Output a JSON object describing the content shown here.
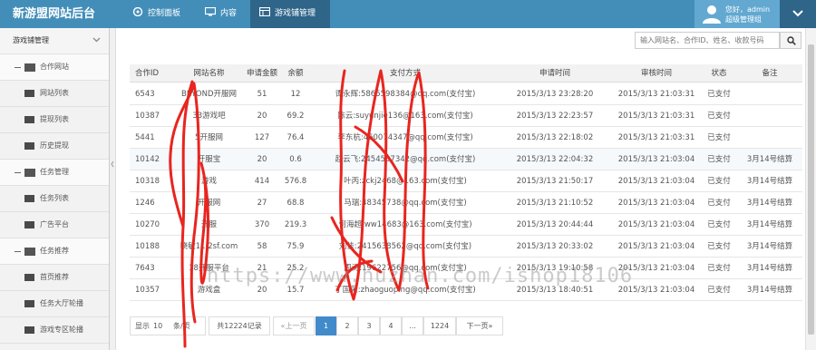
{
  "header": {
    "brand": "新游盟网站后台",
    "tabs": [
      {
        "label": "控制面板",
        "icon": "dashboard-icon",
        "active": false
      },
      {
        "label": "内容",
        "icon": "monitor-icon",
        "active": false
      },
      {
        "label": "游戏铺管理",
        "icon": "grid-icon",
        "active": true
      }
    ],
    "user": {
      "greeting": "您好，admin",
      "role": "超级管理组"
    }
  },
  "sidebar": {
    "title": "游戏铺管理",
    "groups": [
      {
        "label": "合作网站",
        "items": [
          "网站列表",
          "提现列表",
          "历史提现"
        ]
      },
      {
        "label": "任务管理",
        "items": [
          "任务列表",
          "广告平台"
        ]
      },
      {
        "label": "任务推荐",
        "items": [
          "首页推荐",
          "任务大厅轮播",
          "游戏专区轮播"
        ]
      }
    ]
  },
  "search": {
    "placeholder": "输入网站名、合作ID、姓名、收款号码"
  },
  "table": {
    "columns": [
      "合作ID",
      "网站名称",
      "申请金额",
      "余额",
      "支付方式",
      "申请时间",
      "审核时间",
      "状态",
      "备注"
    ],
    "rows": [
      [
        "6543",
        "BEYOND开服网",
        "51",
        "12",
        "谭永辉:5865598384@qq.com(支付宝)",
        "2015/3/13 23:28:20",
        "2015/3/13 21:03:31",
        "已支付",
        ""
      ],
      [
        "10387",
        "33游戏吧",
        "20",
        "69.2",
        "陈云:suyunjie136@163.com(支付宝)",
        "2015/3/13 22:23:57",
        "2015/3/13 21:03:31",
        "已支付",
        ""
      ],
      [
        "5441",
        "5开服网",
        "127",
        "76.4",
        "李东杭:460074347@qq.com(支付宝)",
        "2015/3/13 22:18:02",
        "2015/3/13 21:03:31",
        "已支付",
        ""
      ],
      [
        "10142",
        "开服宝",
        "20",
        "0.6",
        "赵云飞:2454507342@qq.com(支付宝)",
        "2015/3/13 22:04:32",
        "2015/3/13 21:03:04",
        "已支付",
        "3月14号结算"
      ],
      [
        "10318",
        "游戏",
        "414",
        "576.8",
        "叶丙:zckj2468@163.com(支付宝)",
        "2015/3/13 21:50:17",
        "2015/3/13 21:03:04",
        "已支付",
        "3月14号结算"
      ],
      [
        "1246",
        "开服网",
        "27",
        "68.8",
        "马瑞:48345738@qq.com(支付宝)",
        "2015/3/13 21:10:52",
        "2015/3/13 21:03:04",
        "已支付",
        "3月14号结算"
      ],
      [
        "10270",
        "开服",
        "370",
        "219.3",
        "何海超:ww14683@163.com(支付宝)",
        "2015/3/13 20:44:44",
        "2015/3/13 21:03:04",
        "已支付",
        "3月14号结算"
      ],
      [
        "10188",
        "晓敏11.2sf.com",
        "58",
        "75.9",
        "刘佳:2415638562@qq.com(支付宝)",
        "2015/3/13 20:33:02",
        "2015/3/13 21:03:04",
        "已支付",
        "3月14号结算"
      ],
      [
        "7643",
        "18开服平台",
        "21",
        "25.2",
        "周涛:19622756@qq.com(支付宝)",
        "2015/3/13 19:10:58",
        "2015/3/13 21:03:04",
        "已支付",
        "3月14号结算"
      ],
      [
        "10357",
        "游戏盒",
        "20",
        "15.7",
        "丁国荣:zhaoguoping@qq.com(支付宝)",
        "2015/3/13 18:40:51",
        "2015/3/13 21:03:04",
        "已支付",
        "3月14号结算"
      ]
    ]
  },
  "pagination": {
    "show_label": "显示",
    "page_size": "10",
    "page_size_suffix": "条/页",
    "total": "共12224记录",
    "prev": "«上一页",
    "pages": [
      "1",
      "2",
      "3",
      "4",
      "...",
      "1224"
    ],
    "next": "下一页»",
    "current": "1"
  },
  "watermark": "https://www.huzhan.com/ishop18106",
  "colors": {
    "header": "#438eb9",
    "active_tab": "#2e6589",
    "pager_active": "#428bca",
    "scribble": "#e8251f"
  }
}
